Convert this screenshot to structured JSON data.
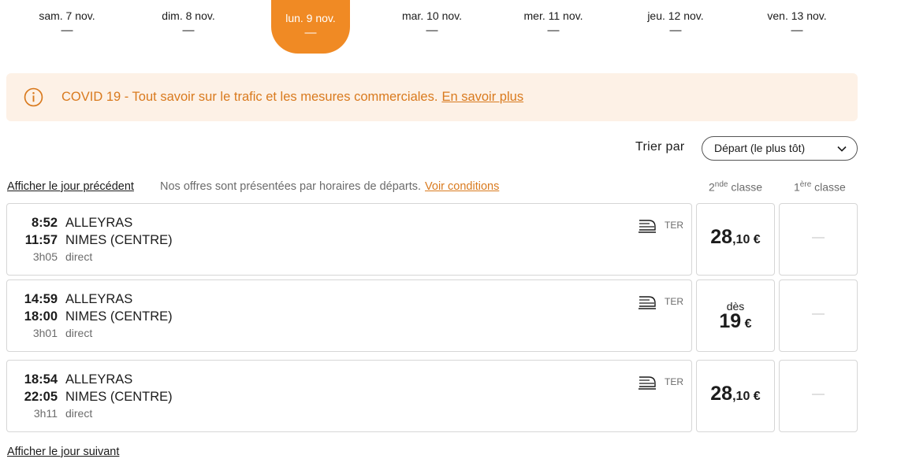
{
  "dates": [
    {
      "label": "sam. 7 nov.",
      "price": "—",
      "active": false
    },
    {
      "label": "dim. 8 nov.",
      "price": "—",
      "active": false
    },
    {
      "label": "lun. 9 nov.",
      "price": "—",
      "active": true
    },
    {
      "label": "mar. 10 nov.",
      "price": "—",
      "active": false
    },
    {
      "label": "mer. 11 nov.",
      "price": "—",
      "active": false
    },
    {
      "label": "jeu. 12 nov.",
      "price": "—",
      "active": false
    },
    {
      "label": "ven. 13 nov.",
      "price": "—",
      "active": false
    }
  ],
  "banner": {
    "icon": "info-icon",
    "text": "COVID 19 - Tout savoir sur le trafic et les mesures commerciales.",
    "link": "En savoir plus"
  },
  "sort": {
    "label": "Trier par",
    "value": "Départ (le plus tôt)"
  },
  "list_header": {
    "prev_day": "Afficher le jour précédent",
    "note": "Nos offres sont présentées par horaires de départs.",
    "conditions": "Voir conditions",
    "class2_num": "2",
    "class2_sup": "nde",
    "class2_word": "classe",
    "class1_num": "1",
    "class1_sup": "ère",
    "class1_word": "classe"
  },
  "trips": [
    {
      "departure": "8:52",
      "arrival": "11:57",
      "duration": "3h05",
      "origin": "ALLEYRAS",
      "destination": "NIMES (CENTRE)",
      "type": "direct",
      "train": "TER",
      "second": {
        "from": "",
        "int": "28",
        "dec": ",10",
        "cur": "€"
      },
      "first": "—"
    },
    {
      "departure": "14:59",
      "arrival": "18:00",
      "duration": "3h01",
      "origin": "ALLEYRAS",
      "destination": "NIMES (CENTRE)",
      "type": "direct",
      "train": "TER",
      "second": {
        "from": "dès",
        "int": "19",
        "dec": "",
        "cur": "€"
      },
      "first": "—"
    },
    {
      "departure": "18:54",
      "arrival": "22:05",
      "duration": "3h11",
      "origin": "ALLEYRAS",
      "destination": "NIMES (CENTRE)",
      "type": "direct",
      "train": "TER",
      "second": {
        "from": "",
        "int": "28",
        "dec": ",10",
        "cur": "€"
      },
      "first": "—"
    }
  ],
  "next_day": "Afficher le jour suivant",
  "colors": {
    "accent": "#f08a24",
    "banner_bg": "#fdf1e6",
    "banner_text": "#d97a1e",
    "muted": "#6b6b6b",
    "border": "#d6d6d6"
  }
}
